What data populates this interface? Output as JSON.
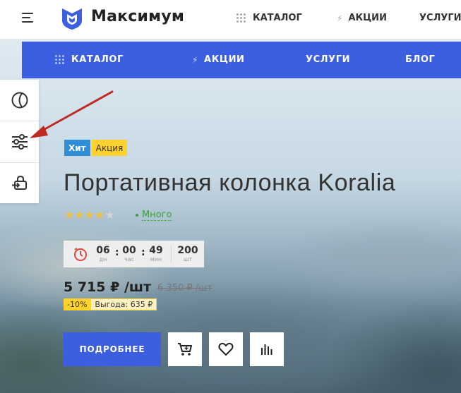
{
  "header": {
    "brand": "Максимум",
    "nav": [
      {
        "label": "КАТАЛОГ",
        "icon": "grid-icon"
      },
      {
        "label": "АКЦИИ",
        "icon": "bolt-icon"
      },
      {
        "label": "УСЛУГИ"
      }
    ]
  },
  "menu": {
    "items": [
      {
        "label": "КАТАЛОГ",
        "icon": "grid-icon"
      },
      {
        "label": "АКЦИИ",
        "icon": "bolt-icon"
      },
      {
        "label": "УСЛУГИ"
      },
      {
        "label": "БЛОГ"
      }
    ]
  },
  "side": {
    "buttons": [
      "theme-toggle-icon",
      "settings-sliders-icon",
      "login-icon"
    ]
  },
  "product": {
    "badges": {
      "hit": "Хит",
      "sale": "Акция"
    },
    "title": "Портативная колонка Koralia",
    "rating": 4,
    "rating_max": 5,
    "stock": "Много",
    "timer": {
      "days": "06",
      "days_label": "дн",
      "hours": "00",
      "hours_label": "час",
      "minutes": "49",
      "minutes_label": "мин",
      "qty": "200",
      "qty_label": "шт"
    },
    "price": "5 715 ₽ /шт",
    "old_price": "6 350 ₽ /шт",
    "discount": "-10%",
    "savings": "Выгода: 635 ₽",
    "more_button": "ПОДРОБНЕЕ"
  },
  "colors": {
    "accent": "#3b5fe0",
    "hit_badge": "#2e8ed8",
    "sale_badge": "#ffd12c",
    "stock": "#3e9e3e",
    "arrow": "#c02a20"
  }
}
